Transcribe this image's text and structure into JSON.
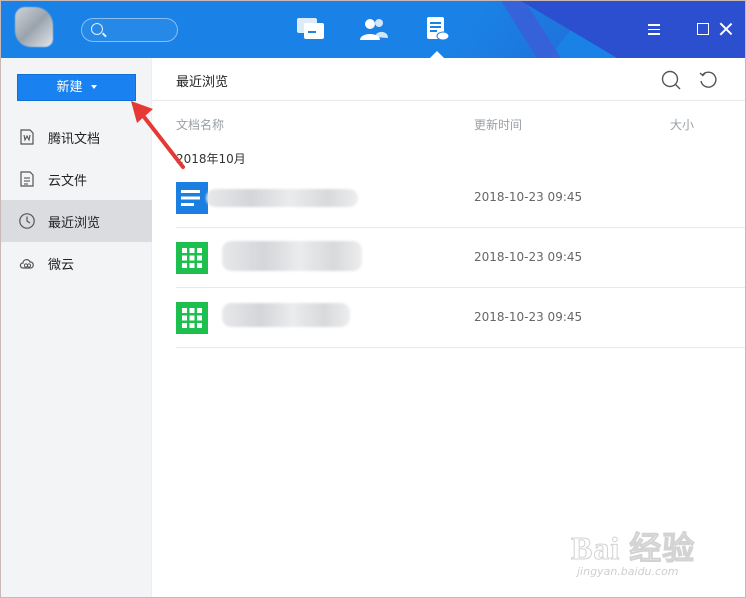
{
  "titlebar": {
    "search": {
      "placeholder": ""
    },
    "nav": [
      {
        "name": "messages-icon"
      },
      {
        "name": "contacts-icon"
      },
      {
        "name": "documents-icon",
        "active": true
      }
    ],
    "window_controls": [
      "menu",
      "maximize",
      "close"
    ]
  },
  "sidebar": {
    "new_button": "新建",
    "items": [
      {
        "label": "腾讯文档",
        "icon": "doc-icon"
      },
      {
        "label": "云文件",
        "icon": "file-icon"
      },
      {
        "label": "最近浏览",
        "icon": "clock-icon",
        "active": true
      },
      {
        "label": "微云",
        "icon": "cloud-icon"
      }
    ]
  },
  "main": {
    "title": "最近浏览",
    "columns": {
      "name": "文档名称",
      "updated": "更新时间",
      "size": "大小"
    },
    "group": "2018年10月",
    "rows": [
      {
        "type": "doc",
        "name": "",
        "updated": "2018-10-23 09:45",
        "size": ""
      },
      {
        "type": "sheet",
        "name": "",
        "updated": "2018-10-23 09:45",
        "size": ""
      },
      {
        "type": "sheet",
        "name": "",
        "updated": "2018-10-23 09:45",
        "size": ""
      }
    ]
  },
  "watermark": {
    "main": "Bai 经验",
    "sub": "jingyan.baidu.com"
  },
  "colors": {
    "titlebar": "#1a82e6",
    "accent": "#1a82f0",
    "sidebar_bg": "#f3f4f6",
    "active_item": "#dadcdf",
    "doc_icon": "#1a7fe0",
    "sheet_icon": "#1dbf4e",
    "arrow": "#e53935"
  }
}
